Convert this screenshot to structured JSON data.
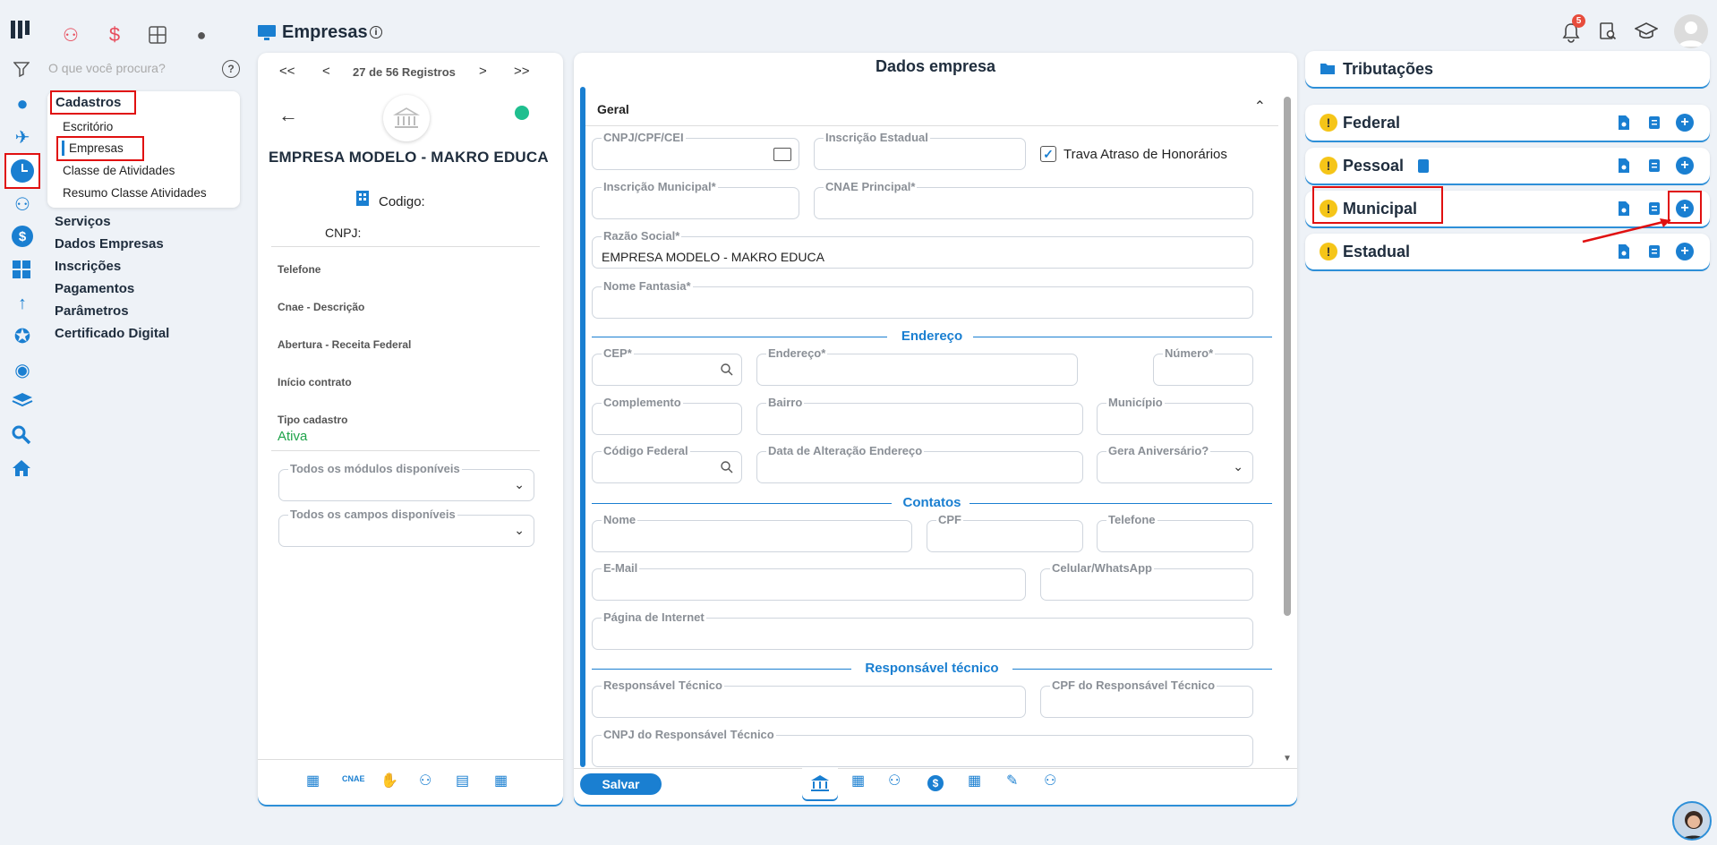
{
  "header": {
    "page_title": "Empresas",
    "notification_count": "5",
    "search_placeholder": "O que você procura?"
  },
  "top_icons": [
    "people-icon",
    "dollar-icon",
    "calculator-icon",
    "money-bag-icon"
  ],
  "sidebar": {
    "cadastros_label": "Cadastros",
    "cadastros_items": [
      "Escritório",
      "Empresas",
      "Classe de Atividades",
      "Resumo Classe Atividades"
    ],
    "sections": [
      "Serviços",
      "Dados Empresas",
      "Inscrições",
      "Pagamentos",
      "Parâmetros",
      "Certificado Digital"
    ]
  },
  "record_panel": {
    "pager": {
      "first": "<<",
      "prev": "<",
      "text": "27 de 56 Registros",
      "next": ">",
      "last": ">>"
    },
    "company_name": "EMPRESA MODELO - MAKRO EDUCA",
    "codigo_label": "Codigo:",
    "cnpj_label": "CNPJ:",
    "info_labels": [
      "Telefone",
      "Cnae - Descrição",
      "Abertura - Receita Federal",
      "Início contrato",
      "Tipo cadastro"
    ],
    "tipo_cadastro_value": "Ativa",
    "modules_label": "Todos os módulos disponíveis",
    "fields_label": "Todos os campos disponíveis",
    "bottom_cnae": "CNAE"
  },
  "form": {
    "title": "Dados empresa",
    "geral_label": "Geral",
    "cnpj_label": "CNPJ/CPF/CEI",
    "ie_label": "Inscrição Estadual",
    "trava_label": "Trava Atraso de Honorários",
    "im_label": "Inscrição Municipal*",
    "cnae_label": "CNAE Principal*",
    "razao_label": "Razão Social*",
    "razao_value": "EMPRESA MODELO  - MAKRO EDUCA",
    "fantasia_label": "Nome Fantasia*",
    "endereco_section": "Endereço",
    "cep_label": "CEP*",
    "endereco_label": "Endereço*",
    "numero_label": "Número*",
    "complemento_label": "Complemento",
    "bairro_label": "Bairro",
    "municipio_label": "Município",
    "codfed_label": "Código Federal",
    "dataalt_label": "Data de Alteração Endereço",
    "aniv_label": "Gera Aniversário?",
    "contatos_section": "Contatos",
    "nome_label": "Nome",
    "cpf_label": "CPF",
    "telefone_label": "Telefone",
    "email_label": "E-Mail",
    "celular_label": "Celular/WhatsApp",
    "pagina_label": "Página de Internet",
    "resp_section": "Responsável técnico",
    "resp_label": "Responsável Técnico",
    "resp_cpf_label": "CPF do Responsável Técnico",
    "resp_cnpj_label": "CNPJ do Responsável Técnico",
    "save_label": "Salvar"
  },
  "tributacoes": {
    "title": "Tributações",
    "items": [
      "Federal",
      "Pessoal",
      "Municipal",
      "Estadual"
    ]
  },
  "colors": {
    "accent": "#1a7fd1",
    "highlight": "#e01010",
    "warning": "#f5c518",
    "active": "#1fbf8f"
  }
}
